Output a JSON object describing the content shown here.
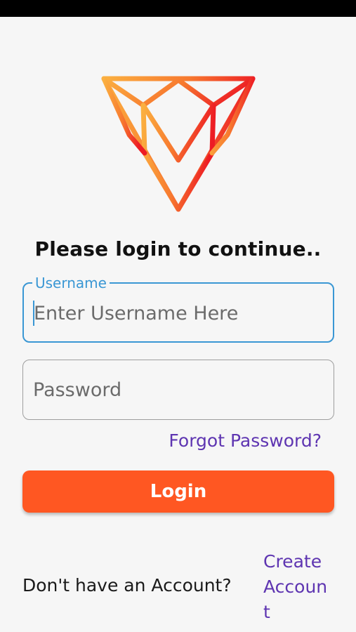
{
  "heading": "Please login to continue..",
  "username": {
    "label": "Username",
    "placeholder": "Enter Username Here"
  },
  "password": {
    "placeholder": "Password"
  },
  "forgot_label": "Forgot Password?",
  "login_label": "Login",
  "signup": {
    "prompt": "Don't have an Account?",
    "link_label": "Create Account"
  },
  "colors": {
    "accent_blue": "#3a97d4",
    "primary_orange": "#ff5722",
    "link_purple": "#5e35b1",
    "logo_gradient_start": "#fbb040",
    "logo_gradient_end": "#ed1c24"
  },
  "icons": {
    "logo": "geometric-shield-logo"
  }
}
